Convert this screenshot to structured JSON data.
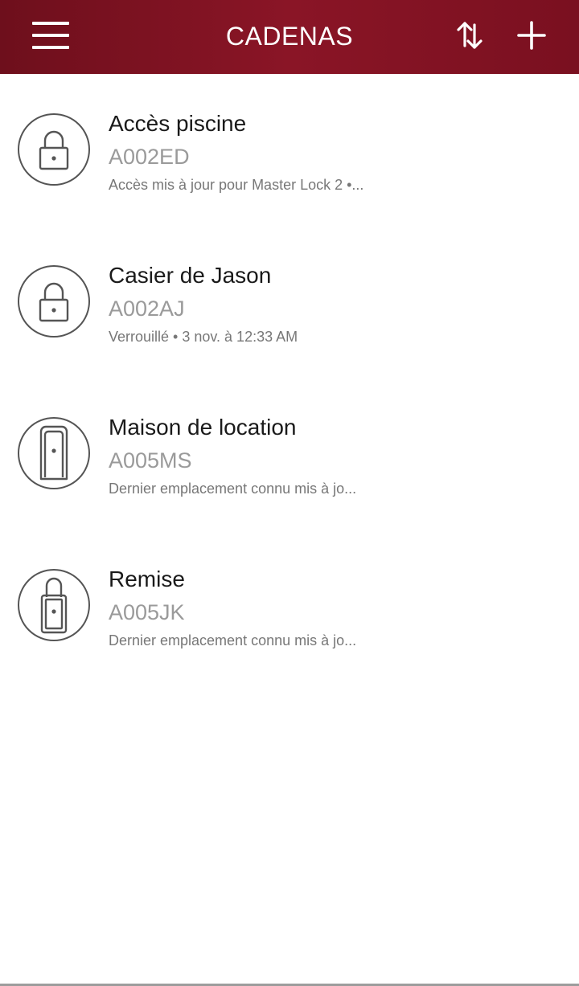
{
  "header": {
    "title": "CADENAS",
    "menu_icon": "hamburger-menu-icon",
    "sort_icon": "sort-arrows-icon",
    "add_icon": "plus-icon",
    "color": "#7a1020"
  },
  "locks": [
    {
      "name": "Accès piscine",
      "code": "A002ED",
      "status": "Accès mis à jour pour Master Lock 2 •...",
      "icon": "padlock-icon"
    },
    {
      "name": "Casier de Jason",
      "code": "A002AJ",
      "status": "Verrouillé • 3 nov. à 12:33 AM",
      "icon": "padlock-icon"
    },
    {
      "name": "Maison de location",
      "code": "A005MS",
      "status": "Dernier emplacement connu mis à jo...",
      "icon": "door-lockbox-icon"
    },
    {
      "name": "Remise",
      "code": "A005JK",
      "status": "Dernier emplacement connu mis à jo...",
      "icon": "shackle-lockbox-icon"
    }
  ]
}
